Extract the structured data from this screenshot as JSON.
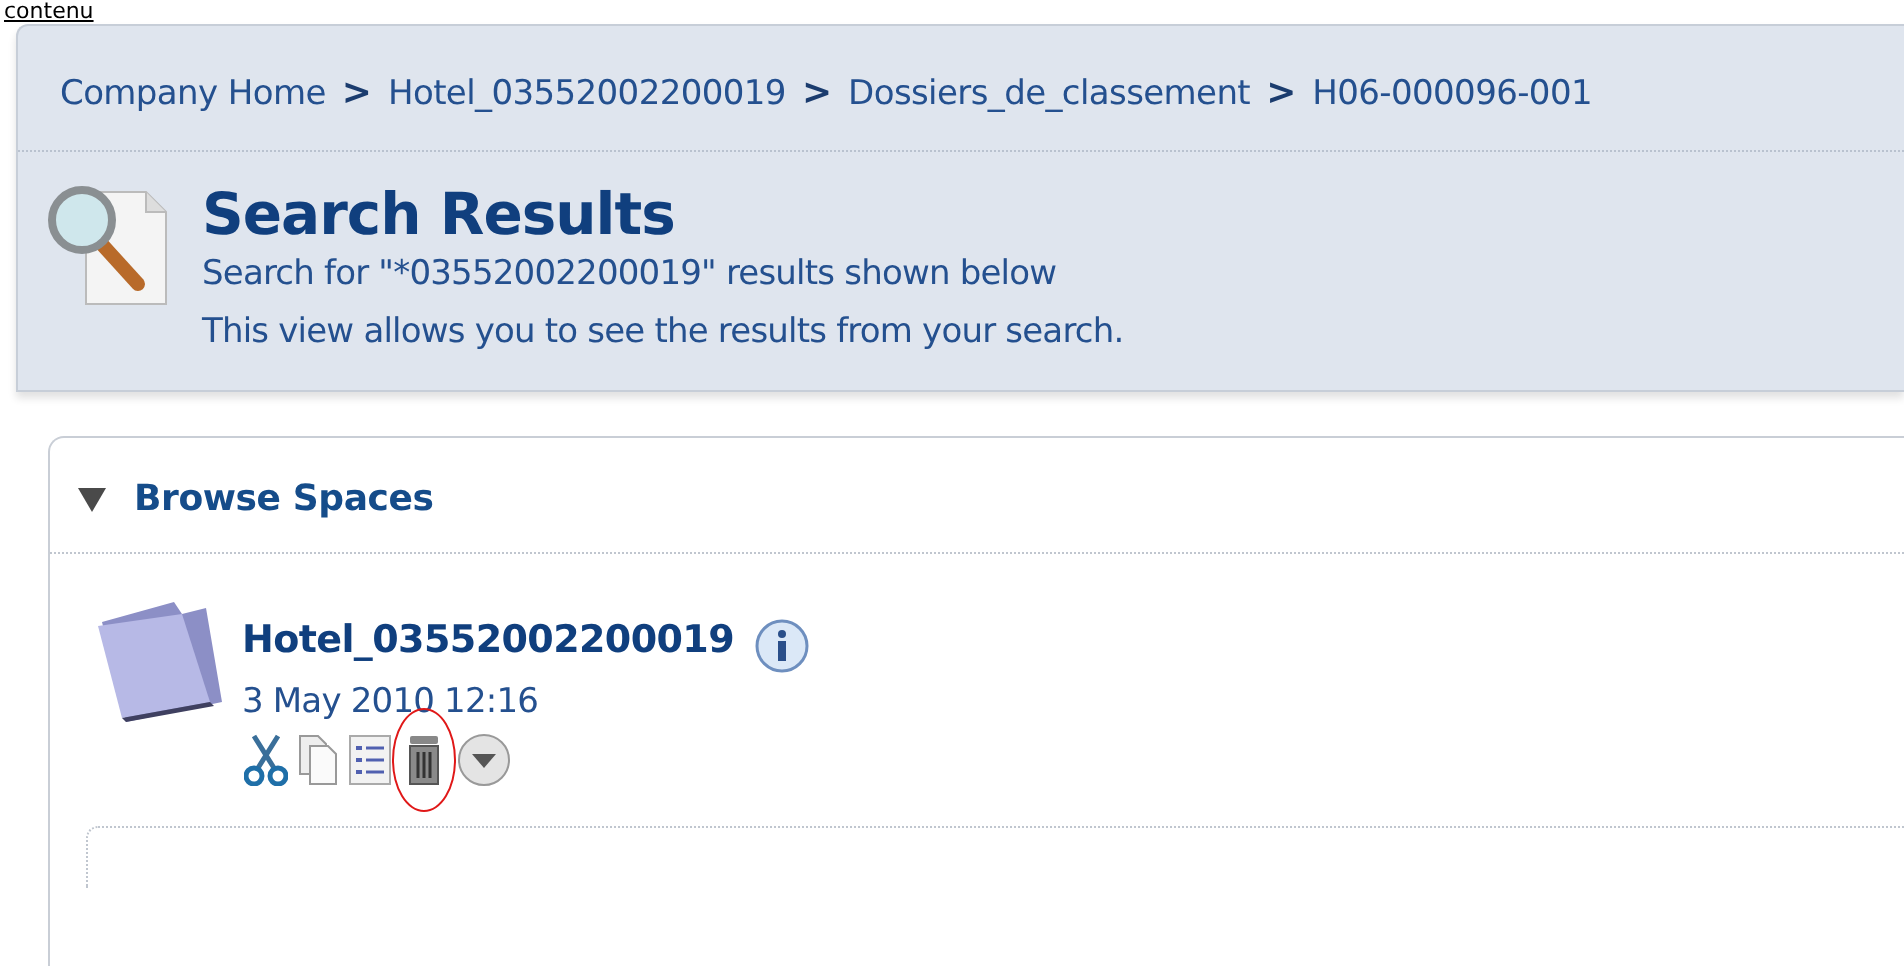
{
  "top_link": "contenu",
  "breadcrumb": [
    {
      "label": "Company Home"
    },
    {
      "label": "Hotel_03552002200019"
    },
    {
      "label": "Dossiers_de_classement"
    },
    {
      "label": "H06-000096-001"
    }
  ],
  "breadcrumb_separator": ">",
  "header": {
    "title": "Search Results",
    "lines": [
      "Search for \"*03552002200019\" results shown below",
      "This view allows you to see the results from your search."
    ]
  },
  "section": {
    "title": "Browse Spaces",
    "expanded": true,
    "items": [
      {
        "name": "Hotel_03552002200019",
        "date": "3 May 2010 12:16",
        "actions": [
          {
            "kind": "cut",
            "highlighted": false
          },
          {
            "kind": "copy",
            "highlighted": false
          },
          {
            "kind": "details",
            "highlighted": false
          },
          {
            "kind": "delete",
            "highlighted": true
          },
          {
            "kind": "more",
            "highlighted": false
          }
        ]
      }
    ]
  }
}
